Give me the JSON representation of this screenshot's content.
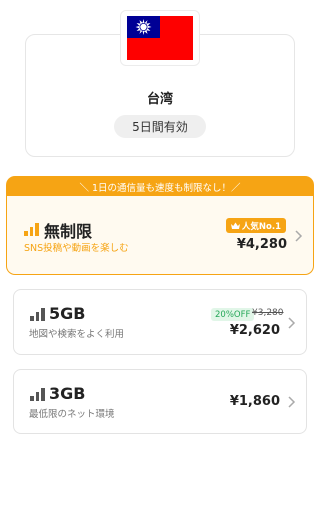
{
  "country": {
    "name": "台湾",
    "duration": "5日間有効"
  },
  "banner": {
    "text": "＼ 1日の通信量も速度も制限なし！／"
  },
  "plans": [
    {
      "title": "無制限",
      "subtitle": "SNS投稿や動画を楽しむ",
      "badge": "人気No.1",
      "price": "¥4,280"
    },
    {
      "title": "5GB",
      "subtitle": "地図や検索をよく利用",
      "discount": "20%OFF",
      "original_price": "¥3,280",
      "price": "¥2,620"
    },
    {
      "title": "3GB",
      "subtitle": "最低限のネット環境",
      "price": "¥1,860"
    }
  ],
  "colors": {
    "accent": "#f6a414",
    "discount_green": "#27a85a",
    "signal_gray": "#555555",
    "flag_red": "#fe0000",
    "flag_blue": "#000095"
  }
}
